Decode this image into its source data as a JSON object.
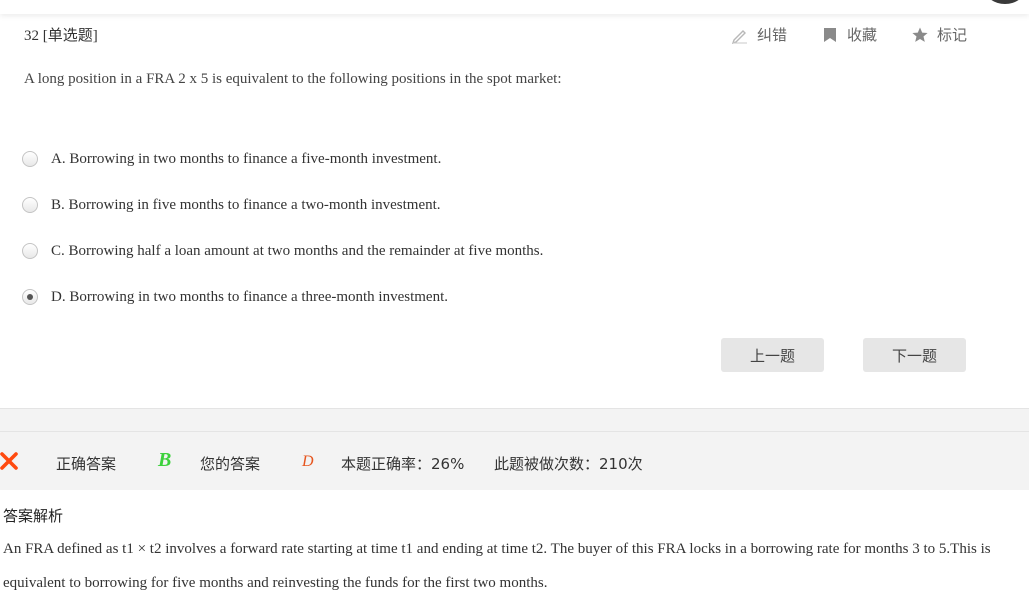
{
  "question": {
    "header": "32 [单选题]",
    "text": "A long position in a FRA 2 x 5 is equivalent to the following positions in the spot market:",
    "options": [
      {
        "label": "A. Borrowing in two months to finance a five-month investment.",
        "selected": false
      },
      {
        "label": "B. Borrowing in five months to finance a two-month investment.",
        "selected": false
      },
      {
        "label": "C. Borrowing half a loan amount at two months and the remainder at five months.",
        "selected": false
      },
      {
        "label": "D. Borrowing in two months to finance a three-month investment.",
        "selected": true
      }
    ]
  },
  "actions": {
    "correct_label": "纠错",
    "favorite_label": "收藏",
    "mark_label": "标记"
  },
  "nav": {
    "prev_label": "上一题",
    "next_label": "下一题"
  },
  "result": {
    "correct_answer_label": "正确答案",
    "correct_answer": "B",
    "your_answer_label": "您的答案",
    "your_answer": "D",
    "accuracy_text": "本题正确率：26%",
    "attempts_text": "此题被做次数：210次"
  },
  "analysis": {
    "title": "答案解析",
    "text": "An FRA defined as t1 × t2 involves a forward rate starting at time t1 and ending at time t2. The buyer of this FRA locks in a borrowing rate for months 3 to 5.This is equivalent to borrowing for five months and reinvesting the funds for the first two months."
  },
  "colors": {
    "correct_green": "#3cd13c",
    "wrong_orange": "#e6551e",
    "button_bg": "#e6e6e6",
    "band_bg": "#f3f3f3"
  },
  "icons": {
    "correct": "pencil-icon",
    "favorite": "bookmark-icon",
    "mark": "star-icon",
    "wrong": "cross-icon"
  }
}
